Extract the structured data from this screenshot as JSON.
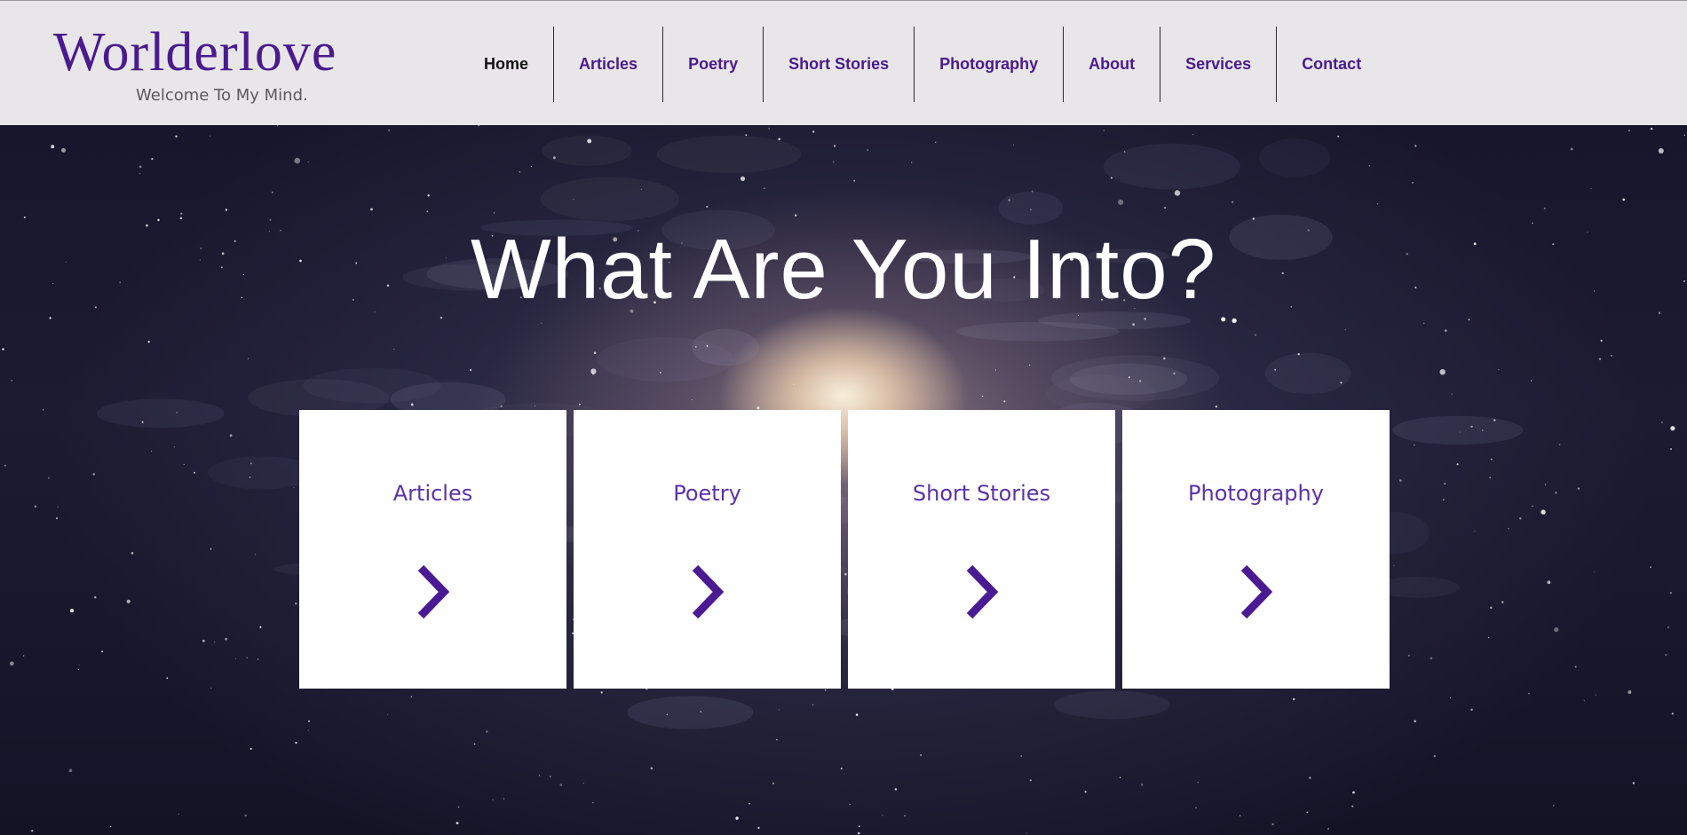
{
  "brand": {
    "title": "Worlderlove",
    "tagline": "Welcome To My Mind."
  },
  "nav": {
    "items": [
      {
        "label": "Home",
        "active": true
      },
      {
        "label": "Articles",
        "active": false
      },
      {
        "label": "Poetry",
        "active": false
      },
      {
        "label": "Short Stories",
        "active": false
      },
      {
        "label": "Photography",
        "active": false
      },
      {
        "label": "About",
        "active": false
      },
      {
        "label": "Services",
        "active": false
      },
      {
        "label": "Contact",
        "active": false
      }
    ]
  },
  "hero": {
    "title": "What Are You Into?",
    "cards": [
      {
        "label": "Articles",
        "icon": "chevron-right-icon"
      },
      {
        "label": "Poetry",
        "icon": "chevron-right-icon"
      },
      {
        "label": "Short Stories",
        "icon": "chevron-right-icon"
      },
      {
        "label": "Photography",
        "icon": "chevron-right-icon"
      }
    ]
  },
  "colors": {
    "brand_purple": "#4a1a8f",
    "card_text_purple": "#5b32a8",
    "header_bg": "#e8e6e8",
    "arrow_purple": "#4b1a93"
  }
}
